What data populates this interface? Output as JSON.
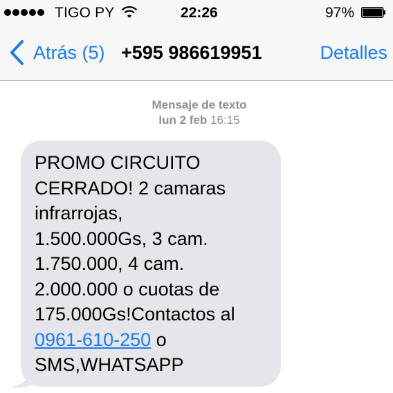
{
  "status_bar": {
    "carrier": "TIGO PY",
    "time": "22:26",
    "battery_percent": "97%",
    "signal_bars": 5,
    "battery_level": 0.97,
    "icons": [
      "signal-dots-icon",
      "wifi-icon",
      "battery-icon"
    ]
  },
  "nav": {
    "back_label": "Atrás (5)",
    "title": "+595 986619951",
    "details_label": "Detalles",
    "accent_color": "#1a7cf4"
  },
  "thread": {
    "meta_kind": "Mensaje de texto",
    "meta_day": "lun 2 feb",
    "meta_time": "16:15",
    "message": {
      "lines": [
        "PROMO CIRCUITO",
        "CERRADO! 2 camaras",
        "infrarrojas,",
        "1.500.000Gs, 3 cam.",
        "1.750.000, 4 cam.",
        "2.000.000 o cuotas de",
        "175.000Gs!Contactos al"
      ],
      "phone_link": "0961-610-250",
      "after_link": " o",
      "last_line": "SMS,WHATSAPP",
      "bubble_color": "#e5e5ea"
    }
  }
}
